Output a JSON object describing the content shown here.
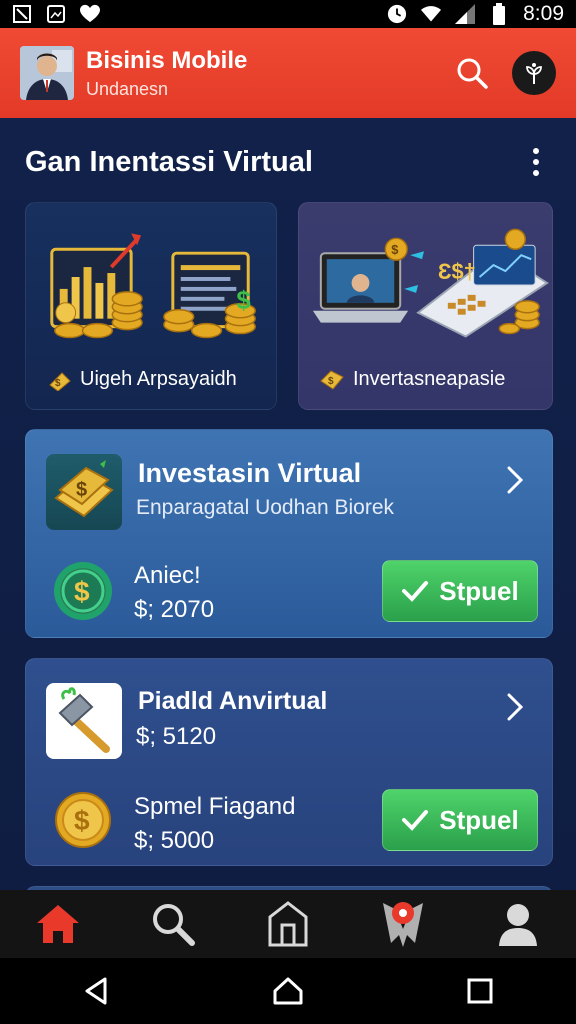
{
  "status_bar": {
    "time": "8:09",
    "icons_left": [
      "nfc-icon",
      "image-icon",
      "heart-icon"
    ],
    "icons_right": [
      "clock-icon",
      "wifi-icon",
      "signal-icon",
      "battery-icon"
    ]
  },
  "header": {
    "title": "Bisinis Mobile",
    "subtitle": "Undanesn",
    "accent_color": "#e23a26"
  },
  "section": {
    "title": "Gan Inentassi Virtual"
  },
  "features": [
    {
      "label": "Uigeh Arpsayaidh",
      "art": "charts-and-coins"
    },
    {
      "label": "Invertasneapasie",
      "art": "laptops-and-coins"
    }
  ],
  "cards": [
    {
      "title": "Investasin Virtual",
      "subtitle": "Enparagatal Uodhan Biorek",
      "row_label": "Aniec!",
      "row_value": "$; 2070",
      "button_label": "Stpuel"
    },
    {
      "title": "Piadld Anvirtual",
      "subtitle": "$; 5120",
      "row_label": "Spmel Fiagand",
      "row_value": "$; 5000",
      "button_label": "Stpuel"
    }
  ],
  "bottom_nav": [
    "home-icon",
    "search-icon",
    "building-icon",
    "location-icon",
    "profile-icon"
  ],
  "colors": {
    "button_green": "#2aa04b",
    "header_red": "#e23a26",
    "background_navy": "#11214a"
  }
}
